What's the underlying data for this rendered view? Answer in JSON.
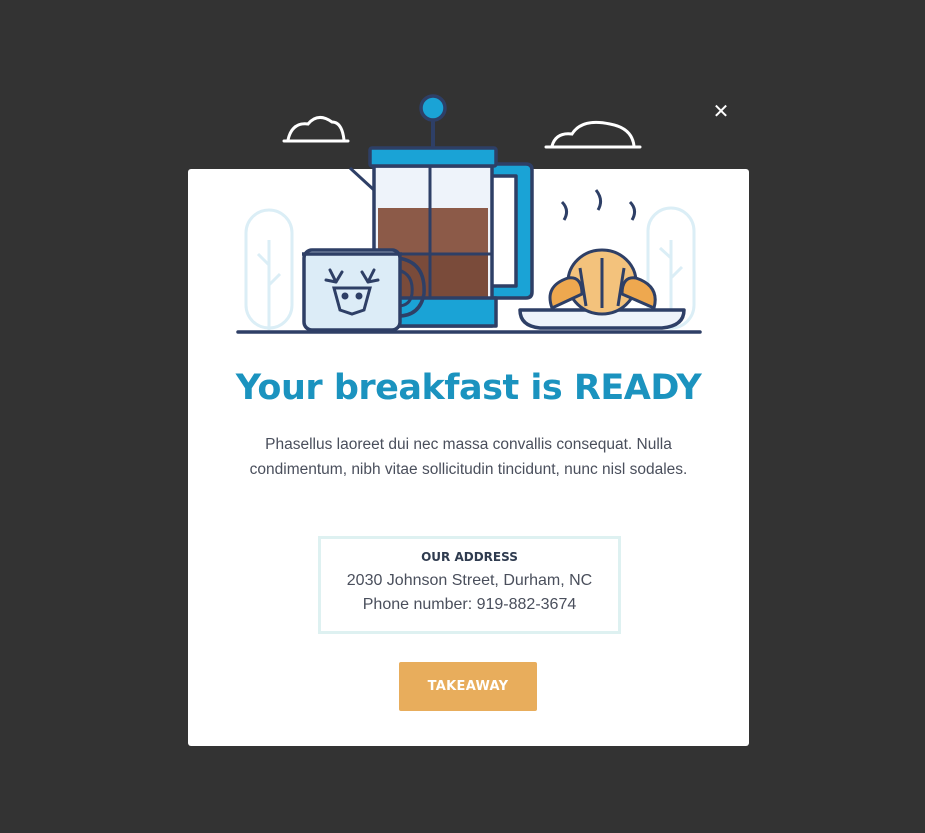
{
  "popup": {
    "close_symbol": "✕",
    "title": "Your breakfast is READY",
    "description": "Phasellus laoreet dui nec massa convallis consequat. Nulla condimentum, nibh vitae sollicitudin tincidunt, nunc nisl sodales.",
    "address": {
      "heading": "OUR ADDRESS",
      "street": "2030 Johnson Street, Durham, NC",
      "phone": "Phone number: 919-882-3674"
    },
    "button_label": "TAKEAWAY"
  },
  "colors": {
    "backdrop": "#333333",
    "modal_bg": "#ffffff",
    "title": "#1b93bf",
    "body_text": "#4a4f5c",
    "button_bg": "#e8ad5c",
    "address_border": "#def1f1",
    "outline": "#2e3f66"
  },
  "icons": [
    "close-icon",
    "cloud-icon",
    "french-press-icon",
    "mug-icon",
    "deer-icon",
    "croissant-icon",
    "tree-icon",
    "plate-icon"
  ]
}
